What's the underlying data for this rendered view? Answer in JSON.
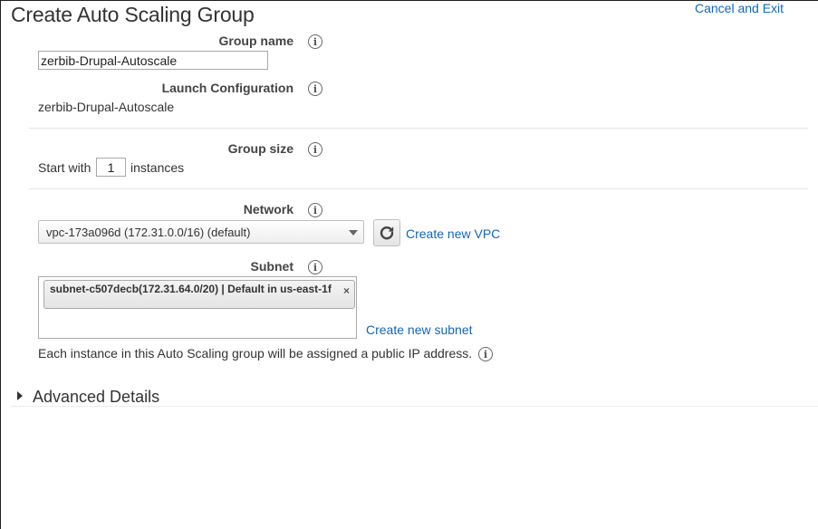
{
  "header": {
    "title": "Create Auto Scaling Group",
    "cancel_label": "Cancel and Exit"
  },
  "icons": {
    "info": "info-icon",
    "refresh": "refresh-icon",
    "dropdown": "chevron-down-icon",
    "close": "close-icon",
    "expand": "expand-arrow-icon"
  },
  "colors": {
    "link": "#1166bb",
    "text": "#333333"
  },
  "form": {
    "group_name": {
      "label": "Group name",
      "value": "zerbib-Drupal-Autoscale"
    },
    "launch_configuration": {
      "label": "Launch Configuration",
      "value": "zerbib-Drupal-Autoscale"
    },
    "group_size": {
      "label": "Group size",
      "prefix": "Start with",
      "value": "1",
      "suffix": "instances"
    },
    "network": {
      "label": "Network",
      "selected": "vpc-173a096d (172.31.0.0/16) (default)",
      "create_label": "Create new VPC"
    },
    "subnet": {
      "label": "Subnet",
      "token": "subnet-c507decb(172.31.64.0/20) | Default in us-east-1f",
      "close_glyph": "×",
      "create_label": "Create new subnet"
    },
    "public_ip_note": "Each instance in this Auto Scaling group will be assigned a public IP address."
  },
  "advanced": {
    "label": "Advanced Details"
  }
}
